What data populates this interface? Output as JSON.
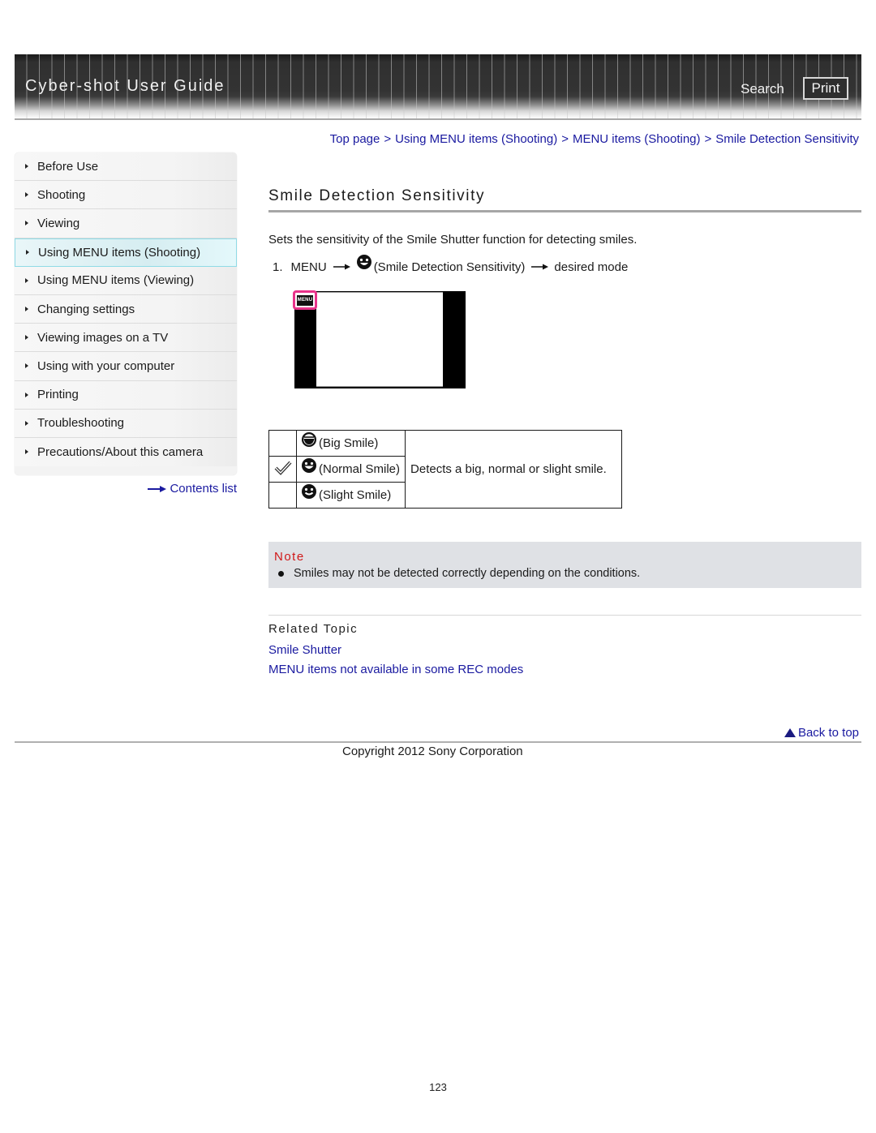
{
  "header": {
    "title": "Cyber-shot User Guide",
    "search_label": "Search",
    "print_label": "Print"
  },
  "breadcrumb": [
    {
      "label": "Top page"
    },
    {
      "label": "Using MENU items (Shooting)"
    },
    {
      "label": "MENU items (Shooting)"
    },
    {
      "label": "Smile Detection Sensitivity"
    }
  ],
  "breadcrumb_separator": ">",
  "sidebar": {
    "items": [
      {
        "label": "Before Use",
        "active": false
      },
      {
        "label": "Shooting",
        "active": false
      },
      {
        "label": "Viewing",
        "active": false
      },
      {
        "label": "Using MENU items (Shooting)",
        "active": true
      },
      {
        "label": "Using MENU items (Viewing)",
        "active": false
      },
      {
        "label": "Changing settings",
        "active": false
      },
      {
        "label": "Viewing images on a TV",
        "active": false
      },
      {
        "label": "Using with your computer",
        "active": false
      },
      {
        "label": "Printing",
        "active": false
      },
      {
        "label": "Troubleshooting",
        "active": false
      },
      {
        "label": "Precautions/About this camera",
        "active": false
      }
    ],
    "contents_link": "Contents list"
  },
  "main": {
    "title": "Smile Detection Sensitivity",
    "intro": "Sets the sensitivity of the Smile Shutter function for detecting smiles.",
    "step": {
      "number": "1.",
      "menu": "MENU",
      "icon": "smile-detection-icon",
      "item": "(Smile Detection Sensitivity)",
      "target": "desired mode"
    },
    "screen_menu_key": "MENU",
    "modes": [
      {
        "label": "(Big Smile)",
        "icon": "big-smile-icon",
        "selected": false
      },
      {
        "label": "(Normal Smile)",
        "icon": "normal-smile-icon",
        "selected": true
      },
      {
        "label": "(Slight Smile)",
        "icon": "slight-smile-icon",
        "selected": false
      }
    ],
    "modes_description": "Detects a big, normal or slight smile.",
    "note": {
      "title": "Note",
      "items": [
        "Smiles may not be detected correctly depending on the conditions."
      ]
    },
    "related": {
      "title": "Related Topic",
      "links": [
        "Smile Shutter",
        "MENU items not available in some REC modes"
      ]
    }
  },
  "footer": {
    "back_to_top": "Back to top",
    "copyright": "Copyright 2012 Sony Corporation",
    "page_number": "123"
  },
  "colors": {
    "link": "#1a1aa0",
    "note_title": "#d01818",
    "note_bg": "#dfe1e5",
    "active_nav_border": "#8fdbe6",
    "menu_highlight": "#e8338a"
  }
}
